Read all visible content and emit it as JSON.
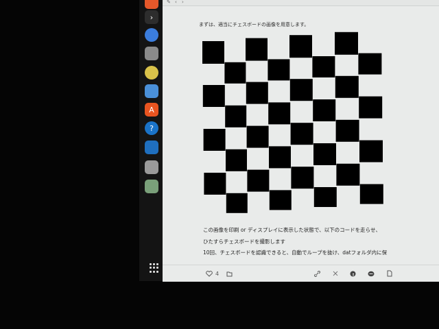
{
  "dock": {
    "items": [
      {
        "name": "ubuntu-software-icon",
        "color": "#e5582a",
        "glyph": ""
      },
      {
        "name": "terminal-icon",
        "color": "#2d2d2d",
        "glyph": "›"
      },
      {
        "name": "browser-icon",
        "color": "#3b7ddd",
        "glyph": ""
      },
      {
        "name": "files-icon",
        "color": "#8a8a8a",
        "glyph": ""
      },
      {
        "name": "rhythmbox-icon",
        "color": "#d9c24a",
        "glyph": ""
      },
      {
        "name": "document-icon",
        "color": "#4a90d9",
        "glyph": ""
      },
      {
        "name": "app-center-icon",
        "color": "#e95420",
        "glyph": "A"
      },
      {
        "name": "help-icon",
        "color": "#1a73c8",
        "glyph": "?"
      },
      {
        "name": "vscode-icon",
        "color": "#1f6fbf",
        "glyph": ""
      },
      {
        "name": "screenshot-icon",
        "color": "#9a9a9a",
        "glyph": ""
      },
      {
        "name": "trash-icon",
        "color": "#7aa07a",
        "glyph": ""
      }
    ],
    "show_apps_label": ""
  },
  "article": {
    "intro": "まずは、適当にチェスボードの画像を用意します。",
    "paragraph_lines": [
      "この画像を印刷 or ディスプレイに表示した状態で、以下のコードを走らせ、",
      "ひたすらチェスボードを撮影します",
      "10回、チェスボードを認識できると、自動でループを抜け、datフォルダ内に保"
    ]
  },
  "footer": {
    "like_count": "4",
    "colors": {
      "icon": "#555555"
    }
  },
  "chessboard": {
    "rows": 8,
    "cols": 8,
    "dark": "#000000",
    "light": "#ffffff"
  }
}
